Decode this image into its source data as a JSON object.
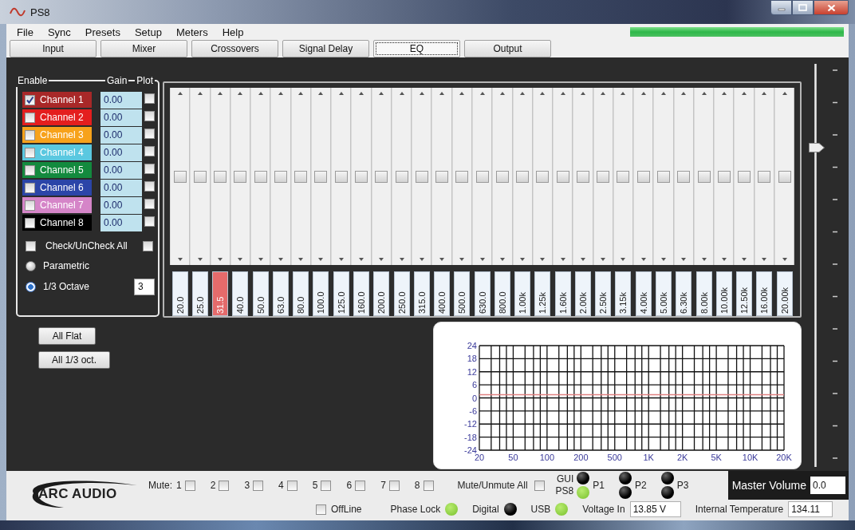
{
  "window": {
    "title": "PS8"
  },
  "menu": [
    "File",
    "Sync",
    "Presets",
    "Setup",
    "Meters",
    "Help"
  ],
  "progress": {
    "level": 1
  },
  "tabs": [
    {
      "label": "Input",
      "selected": false
    },
    {
      "label": "Mixer",
      "selected": false
    },
    {
      "label": "Crossovers",
      "selected": false
    },
    {
      "label": "Signal Delay",
      "selected": false
    },
    {
      "label": "EQ",
      "selected": true
    },
    {
      "label": "Output",
      "selected": false
    }
  ],
  "channels_panel": {
    "headers": {
      "enable": "Enable",
      "gain": "Gain",
      "plot": "Plot"
    },
    "channels": [
      {
        "name": "Channel 1",
        "color": "#a82828",
        "enabled": true,
        "gain": "0.00",
        "plot": false
      },
      {
        "name": "Channel 2",
        "color": "#e41e1e",
        "enabled": false,
        "gain": "0.00",
        "plot": false
      },
      {
        "name": "Channel 3",
        "color": "#f7a21b",
        "enabled": false,
        "gain": "0.00",
        "plot": false
      },
      {
        "name": "Channel 4",
        "color": "#5ac8e0",
        "enabled": false,
        "gain": "0.00",
        "plot": false
      },
      {
        "name": "Channel 5",
        "color": "#138a3e",
        "enabled": false,
        "gain": "0.00",
        "plot": false
      },
      {
        "name": "Channel 6",
        "color": "#2b45a8",
        "enabled": false,
        "gain": "0.00",
        "plot": false
      },
      {
        "name": "Channel 7",
        "color": "#d585c8",
        "enabled": false,
        "gain": "0.00",
        "plot": false
      },
      {
        "name": "Channel 8",
        "color": "#000000",
        "enabled": false,
        "gain": "0.00",
        "plot": false
      }
    ],
    "check_all": {
      "label": "Check/UnCheck All",
      "checked": false,
      "plot_checked": false
    },
    "modes": [
      {
        "label": "Parametric",
        "selected": false
      },
      {
        "label": "1/3 Octave",
        "selected": true
      }
    ],
    "octave_value": "3"
  },
  "eq": {
    "bands": [
      {
        "freq": "20.0",
        "level": 0.5,
        "selected": false
      },
      {
        "freq": "25.0",
        "level": 0.5,
        "selected": false
      },
      {
        "freq": "31.5",
        "level": 0.5,
        "selected": true
      },
      {
        "freq": "40.0",
        "level": 0.5,
        "selected": false
      },
      {
        "freq": "50.0",
        "level": 0.5,
        "selected": false
      },
      {
        "freq": "63.0",
        "level": 0.5,
        "selected": false
      },
      {
        "freq": "80.0",
        "level": 0.5,
        "selected": false
      },
      {
        "freq": "100.0",
        "level": 0.5,
        "selected": false
      },
      {
        "freq": "125.0",
        "level": 0.5,
        "selected": false
      },
      {
        "freq": "160.0",
        "level": 0.5,
        "selected": false
      },
      {
        "freq": "200.0",
        "level": 0.5,
        "selected": false
      },
      {
        "freq": "250.0",
        "level": 0.5,
        "selected": false
      },
      {
        "freq": "315.0",
        "level": 0.5,
        "selected": false
      },
      {
        "freq": "400.0",
        "level": 0.5,
        "selected": false
      },
      {
        "freq": "500.0",
        "level": 0.5,
        "selected": false
      },
      {
        "freq": "630.0",
        "level": 0.5,
        "selected": false
      },
      {
        "freq": "800.0",
        "level": 0.5,
        "selected": false
      },
      {
        "freq": "1.00k",
        "level": 0.5,
        "selected": false
      },
      {
        "freq": "1.25k",
        "level": 0.5,
        "selected": false
      },
      {
        "freq": "1.60k",
        "level": 0.5,
        "selected": false
      },
      {
        "freq": "2.00k",
        "level": 0.5,
        "selected": false
      },
      {
        "freq": "2.50k",
        "level": 0.5,
        "selected": false
      },
      {
        "freq": "3.15k",
        "level": 0.5,
        "selected": false
      },
      {
        "freq": "4.00k",
        "level": 0.5,
        "selected": false
      },
      {
        "freq": "5.00k",
        "level": 0.5,
        "selected": false
      },
      {
        "freq": "6.30k",
        "level": 0.5,
        "selected": false
      },
      {
        "freq": "8.00k",
        "level": 0.5,
        "selected": false
      },
      {
        "freq": "10.00k",
        "level": 0.5,
        "selected": false
      },
      {
        "freq": "12.50k",
        "level": 0.5,
        "selected": false
      },
      {
        "freq": "16.00k",
        "level": 0.5,
        "selected": false
      },
      {
        "freq": "20.00k",
        "level": 0.5,
        "selected": false
      }
    ]
  },
  "eq_buttons": [
    "All Flat",
    "All 1/3 oct."
  ],
  "response_chart": {
    "chart_data": {
      "type": "line",
      "categories": [
        "20",
        "50",
        "100",
        "200",
        "500",
        "1K",
        "2K",
        "5K",
        "10K",
        "20K"
      ],
      "series": [
        {
          "color": "#e08080",
          "values": [
            1.5,
            1.5,
            1.5,
            1.5,
            1.5,
            1.5,
            1.5,
            1.5,
            1.5,
            1.5
          ]
        }
      ],
      "ylim": [
        -24,
        24
      ],
      "grid": true,
      "yticks": [
        24,
        18,
        12,
        6,
        0,
        -6,
        -12,
        -18,
        -24
      ]
    }
  },
  "master_slider": {
    "level": 0.8
  },
  "footer": {
    "logo": "ARC AUDIO",
    "mute": {
      "label": "Mute:",
      "channels": [
        {
          "label": "1",
          "checked": false
        },
        {
          "label": "2",
          "checked": false
        },
        {
          "label": "3",
          "checked": false
        },
        {
          "label": "4",
          "checked": false
        },
        {
          "label": "5",
          "checked": false
        },
        {
          "label": "6",
          "checked": false
        },
        {
          "label": "7",
          "checked": false
        },
        {
          "label": "8",
          "checked": false
        }
      ],
      "all": {
        "label": "Mute/Unmute All",
        "checked": false
      }
    },
    "source_labels": [
      "GUI",
      "PS8"
    ],
    "presets": [
      {
        "label": "P1",
        "leds": [
          {
            "on": false
          },
          {
            "on": true
          }
        ]
      },
      {
        "label": "P2",
        "leds": [
          {
            "on": false
          },
          {
            "on": false
          }
        ]
      },
      {
        "label": "P3",
        "leds": [
          {
            "on": false
          },
          {
            "on": false
          }
        ]
      }
    ],
    "master_volume": {
      "label": "Master Volume",
      "value": "0.0"
    },
    "offline": {
      "label": "OffLine",
      "checked": false
    },
    "indicators": [
      {
        "label": "Phase Lock",
        "on": true
      },
      {
        "label": "Digital",
        "on": false
      },
      {
        "label": "USB",
        "on": true
      }
    ],
    "voltage": {
      "label": "Voltage In",
      "value": "13.85 V"
    },
    "temperature": {
      "label": "Internal Temperature",
      "value": "134.11"
    }
  }
}
